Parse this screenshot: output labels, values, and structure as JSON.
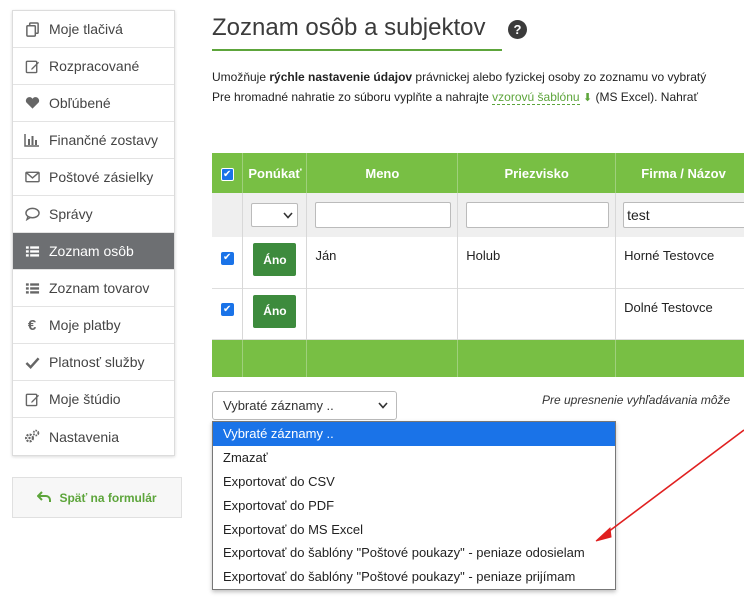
{
  "sidebar": {
    "items": [
      {
        "label": "Moje tlačivá",
        "icon": "copy-icon",
        "active": false
      },
      {
        "label": "Rozpracované",
        "icon": "edit-icon",
        "active": false
      },
      {
        "label": "Obľúbené",
        "icon": "heart-icon",
        "active": false
      },
      {
        "label": "Finančné zostavy",
        "icon": "bar-chart-icon",
        "active": false
      },
      {
        "label": "Poštové zásielky",
        "icon": "envelope-icon",
        "active": false
      },
      {
        "label": "Správy",
        "icon": "comment-icon",
        "active": false
      },
      {
        "label": "Zoznam osôb",
        "icon": "list-icon",
        "active": true
      },
      {
        "label": "Zoznam tovarov",
        "icon": "list-icon",
        "active": false
      },
      {
        "label": "Moje platby",
        "icon": "euro-icon",
        "active": false
      },
      {
        "label": "Platnosť služby",
        "icon": "check-icon",
        "active": false
      },
      {
        "label": "Moje štúdio",
        "icon": "edit-icon",
        "active": false
      },
      {
        "label": "Nastavenia",
        "icon": "gears-icon",
        "active": false
      }
    ],
    "back_label": "Späť na formulár"
  },
  "page": {
    "title": "Zoznam osôb a subjektov",
    "intro_line1_a": "Umožňuje ",
    "intro_line1_bold": "rýchle nastavenie údajov",
    "intro_line1_b": " právnickej alebo fyzickej osoby zo zoznamu vo vybratý",
    "intro_line2_a": "Pre hromadné nahratie zo súboru vyplňte a nahrajte ",
    "intro_line2_link": "vzorovú šablónu",
    "intro_line2_b": " (MS Excel). Nahrať"
  },
  "table": {
    "headers": [
      "Ponúkať",
      "Meno",
      "Priezvisko",
      "Firma / Názov"
    ],
    "filters": {
      "meno": "",
      "priezvisko": "",
      "firma": "test"
    },
    "rows": [
      {
        "checked": true,
        "offer": "Áno",
        "meno": "Ján",
        "priezvisko": "Holub",
        "firma": "Horné Testovce"
      },
      {
        "checked": true,
        "offer": "Áno",
        "meno": "",
        "priezvisko": "",
        "firma": "Dolné Testovce"
      }
    ]
  },
  "controls": {
    "select_label": "Vybraté záznamy ..",
    "hint": "Pre upresnenie vyhľadávania môže",
    "options": [
      "Vybraté záznamy ..",
      "Zmazať",
      "Exportovať do CSV",
      "Exportovať do PDF",
      "Exportovať do MS Excel",
      "Exportovať do šablóny \"Poštové poukazy\" - peniaze odosielam",
      "Exportovať do šablóny \"Poštové poukazy\" - peniaze prijímam"
    ],
    "selected_index": 0
  },
  "colors": {
    "accent_green": "#78bf44",
    "dark_green": "#3d8b3d",
    "selection_blue": "#1a73e8",
    "annotation_red": "#e02020"
  }
}
